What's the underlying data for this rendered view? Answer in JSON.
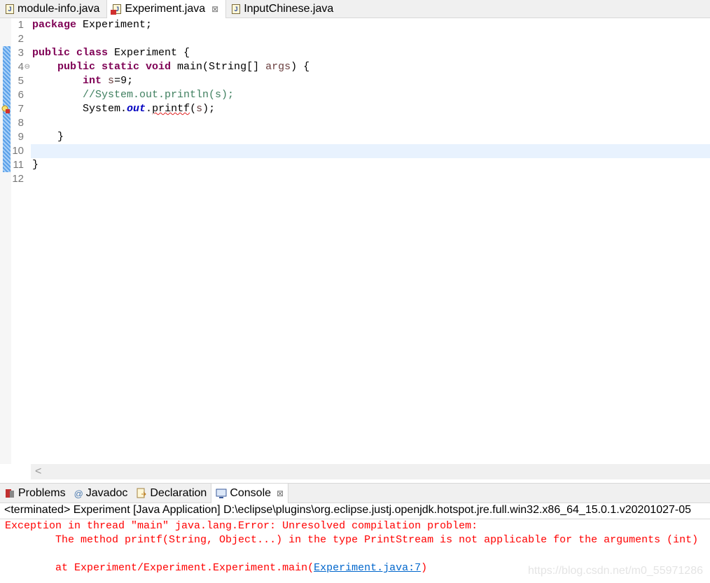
{
  "editor_tabs": [
    {
      "label": "module-info.java",
      "icon": "java-file-icon",
      "active": false
    },
    {
      "label": "Experiment.java",
      "icon": "java-file-error-icon",
      "active": true,
      "close": "⊠"
    },
    {
      "label": "InputChinese.java",
      "icon": "java-file-icon",
      "active": false
    }
  ],
  "code_lines": [
    {
      "n": "1"
    },
    {
      "n": "2"
    },
    {
      "n": "3"
    },
    {
      "n": "4",
      "fold": "⊖"
    },
    {
      "n": "5"
    },
    {
      "n": "6"
    },
    {
      "n": "7"
    },
    {
      "n": "8"
    },
    {
      "n": "9"
    },
    {
      "n": "10"
    },
    {
      "n": "11"
    },
    {
      "n": "12"
    }
  ],
  "code": {
    "l1": [
      "package",
      " Experiment;"
    ],
    "l3": [
      "public class",
      " Experiment {"
    ],
    "l4": [
      "    ",
      "public static void",
      " main(String[] ",
      "args",
      ") {"
    ],
    "l5": [
      "        ",
      "int",
      " ",
      "s",
      "=9;"
    ],
    "l6": [
      "        ",
      "//System.out.println(s);"
    ],
    "l7": [
      "        System.",
      "out",
      ".",
      "printf",
      "(",
      "s",
      ");"
    ],
    "l9": [
      "    }"
    ],
    "l11": [
      "}"
    ]
  },
  "scroll_left": "<",
  "panel_tabs": [
    {
      "label": "Problems",
      "icon": "problems-icon"
    },
    {
      "label": "Javadoc",
      "icon": "@"
    },
    {
      "label": "Declaration",
      "icon": "declaration-icon"
    },
    {
      "label": "Console",
      "icon": "console-icon",
      "active": true,
      "close": "⊠"
    }
  ],
  "console": {
    "status": "<terminated> Experiment [Java Application] D:\\eclipse\\plugins\\org.eclipse.justj.openjdk.hotspot.jre.full.win32.x86_64_15.0.1.v20201027-05",
    "line1": "Exception in thread \"main\" java.lang.Error: Unresolved compilation problem: ",
    "line2": "\tThe method printf(String, Object...) in the type PrintStream is not applicable for the arguments (int)",
    "line3_prefix": "\tat Experiment/Experiment.Experiment.main(",
    "line3_link": "Experiment.java:7",
    "line3_suffix": ")"
  },
  "watermark": "https://blog.csdn.net/m0_55971286",
  "colors": {
    "keyword": "#7f0055",
    "comment": "#3f7f5f",
    "field": "#0000c0",
    "error": "#ff0000",
    "link": "#0066cc",
    "current_line": "#e8f2fe"
  }
}
